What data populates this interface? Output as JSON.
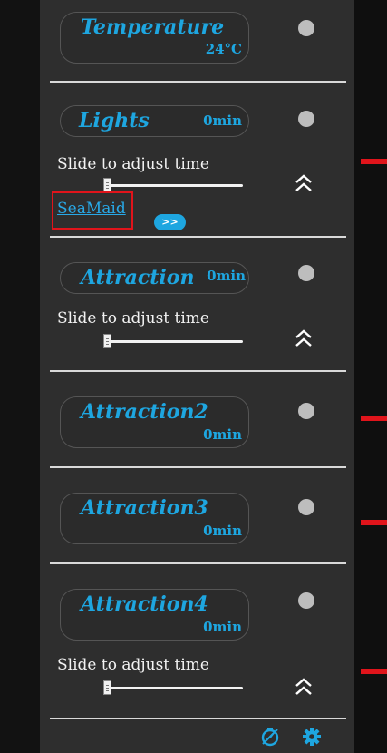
{
  "temperature": {
    "title": "Temperature",
    "value": "24°C"
  },
  "lights": {
    "title": "Lights",
    "value": "0min",
    "slider_label": "Slide to adjust time",
    "link": "SeaMaid",
    "go_label": ">>"
  },
  "attraction": {
    "title": "Attraction",
    "value": "0min",
    "slider_label": "Slide to adjust time"
  },
  "attraction2": {
    "title": "Attraction2",
    "value": "0min"
  },
  "attraction3": {
    "title": "Attraction3",
    "value": "0min"
  },
  "attraction4": {
    "title": "Attraction4",
    "value": "0min",
    "slider_label": "Slide to adjust time"
  },
  "colors": {
    "accent": "#1ea6e0",
    "marker": "#e0141b",
    "panel": "#2e2e2e"
  },
  "icons": {
    "expand": "chevron-double-up-icon",
    "status": "status-dot-icon",
    "timer": "timer-off-icon",
    "settings": "gear-icon"
  }
}
